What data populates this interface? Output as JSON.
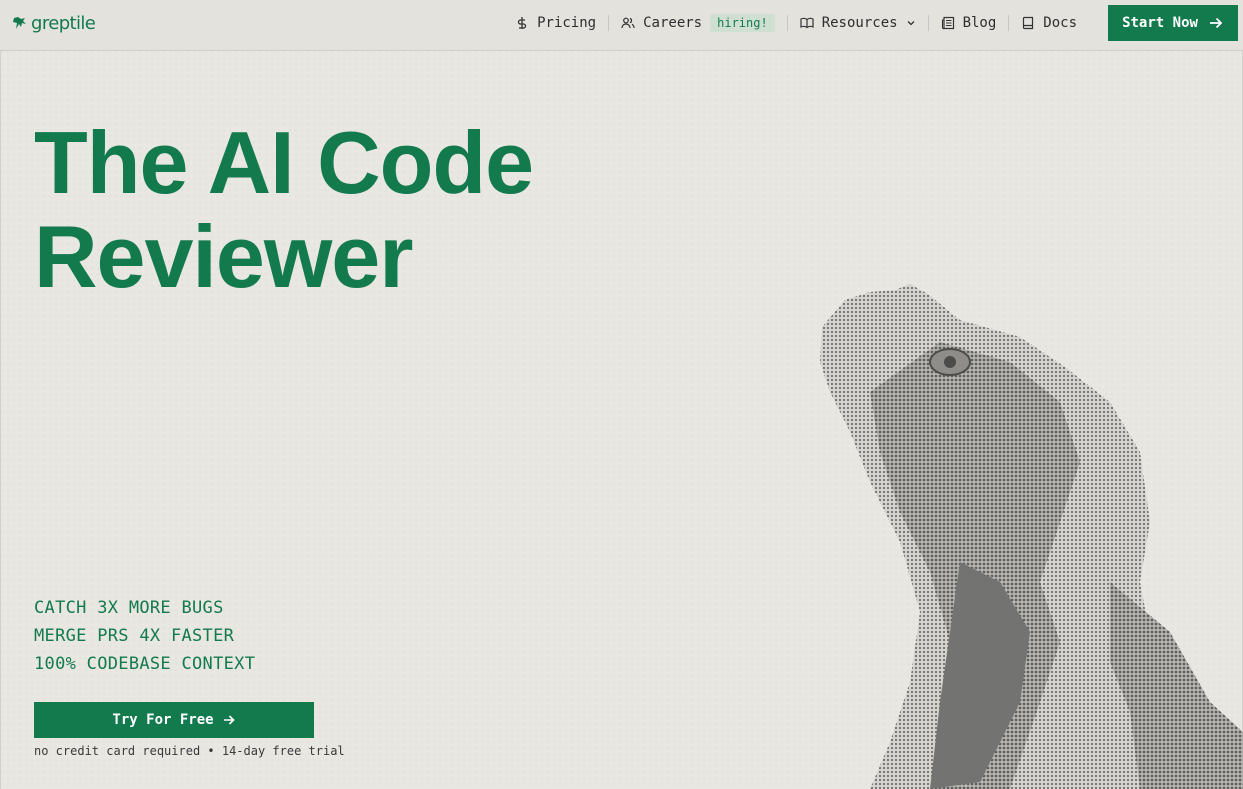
{
  "brand": {
    "name": "greptile"
  },
  "nav": {
    "links": [
      {
        "label": "Pricing",
        "icon": "dollar-icon"
      },
      {
        "label": "Careers",
        "icon": "users-icon",
        "badge": "hiring!"
      },
      {
        "label": "Resources",
        "icon": "book-open-icon",
        "dropdown": true
      },
      {
        "label": "Blog",
        "icon": "newspaper-icon"
      },
      {
        "label": "Docs",
        "icon": "book-icon"
      }
    ],
    "cta_label": "Start Now"
  },
  "hero": {
    "headline_line1": "The AI Code",
    "headline_line2": "Reviewer",
    "features": [
      "CATCH 3X MORE BUGS",
      "MERGE PRS 4X FASTER",
      "100% CODEBASE CONTEXT"
    ],
    "cta_label": "Try For Free",
    "note": "no credit card required • 14-day free trial"
  },
  "colors": {
    "accent": "#137a4e",
    "background": "#e9e7e1",
    "nav_bg": "#e3e2dd",
    "badge_bg": "#cfe0d2"
  }
}
